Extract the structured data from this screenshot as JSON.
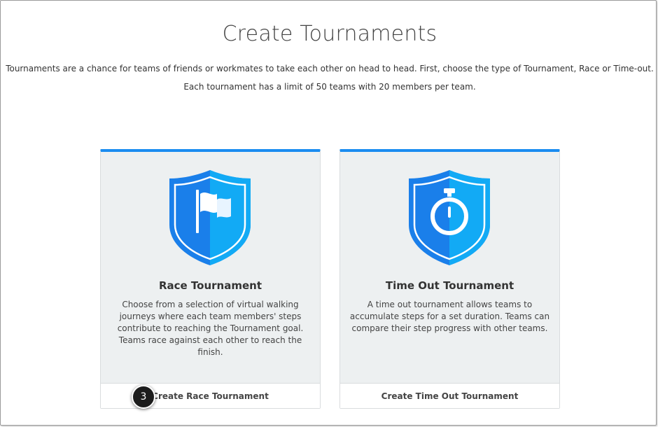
{
  "page": {
    "title": "Create Tournaments",
    "intro_line1": "Tournaments are a chance for teams of friends or workmates to take each other on head to head. First, choose the type of Tournament, Race or Time-out.",
    "intro_line2": "Each tournament has a limit of 50 teams with 20 members per team."
  },
  "colors": {
    "accent": "#1a8cf0",
    "shield_dark": "#1a7fea",
    "shield_light": "#12aaf5",
    "card_bg": "#edf0f1"
  },
  "cards": [
    {
      "icon": "race-flag-shield-icon",
      "title": "Race Tournament",
      "description": "Choose from a selection of virtual walking journeys where each team members' steps contribute to reaching the Tournament goal. Teams race against each other to reach the finish.",
      "button_label": "Create Race Tournament"
    },
    {
      "icon": "stopwatch-shield-icon",
      "title": "Time Out Tournament",
      "description": "A time out tournament allows teams to accumulate steps for a set duration. Teams can compare their step progress with other teams.",
      "button_label": "Create Time Out Tournament"
    }
  ],
  "annotation": {
    "step_number": "3"
  }
}
